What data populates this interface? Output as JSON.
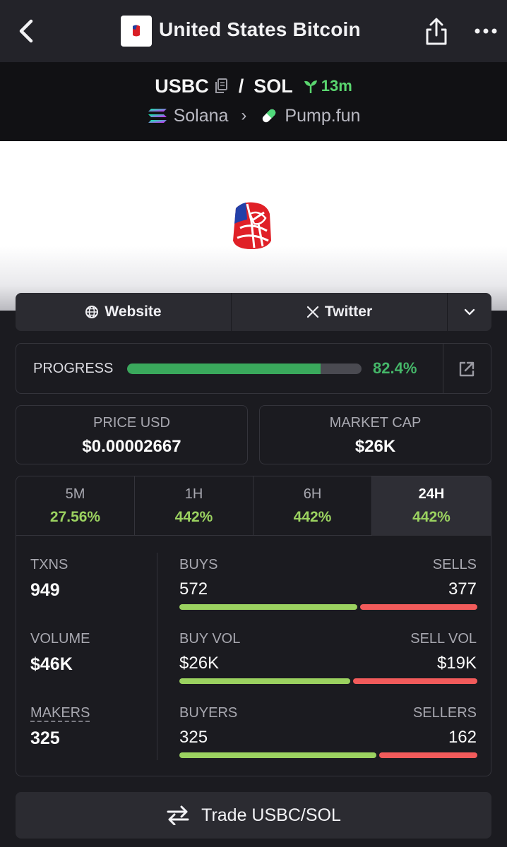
{
  "header": {
    "title": "United States Bitcoin"
  },
  "pair": {
    "base": "USBC",
    "separator": "/",
    "quote": "SOL",
    "age": "13m",
    "chain": "Solana",
    "dex": "Pump.fun"
  },
  "links": {
    "website": "Website",
    "twitter": "Twitter"
  },
  "progress": {
    "label": "PROGRESS",
    "value_text": "82.4%",
    "fraction": 0.824
  },
  "stats": {
    "price_label": "PRICE USD",
    "price_value": "$0.00002667",
    "mcap_label": "MARKET CAP",
    "mcap_value": "$26K"
  },
  "timeframes": [
    {
      "label": "5M",
      "change": "27.56%"
    },
    {
      "label": "1H",
      "change": "442%"
    },
    {
      "label": "6H",
      "change": "442%"
    },
    {
      "label": "24H",
      "change": "442%",
      "active": true
    }
  ],
  "metrics": {
    "txns_label": "TXNS",
    "txns_value": "949",
    "volume_label": "VOLUME",
    "volume_value": "$46K",
    "makers_label": "MAKERS",
    "makers_value": "325"
  },
  "breakdown": {
    "buys_label": "BUYS",
    "buys_value": "572",
    "sells_label": "SELLS",
    "sells_value": "377",
    "buy_vol_label": "BUY VOL",
    "buy_vol_value": "$26K",
    "sell_vol_label": "SELL VOL",
    "sell_vol_value": "$19K",
    "buyers_label": "BUYERS",
    "buyers_value": "325",
    "sellers_label": "SELLERS",
    "sellers_value": "162",
    "buys_fraction": 0.603,
    "buy_vol_fraction": 0.578,
    "buyers_fraction": 0.667
  },
  "trade": {
    "label": "Trade USBC/SOL"
  },
  "colors": {
    "positive": "#9bd260",
    "negative": "#f25b5b",
    "progress": "#3aa95c",
    "age": "#5ad66f"
  }
}
